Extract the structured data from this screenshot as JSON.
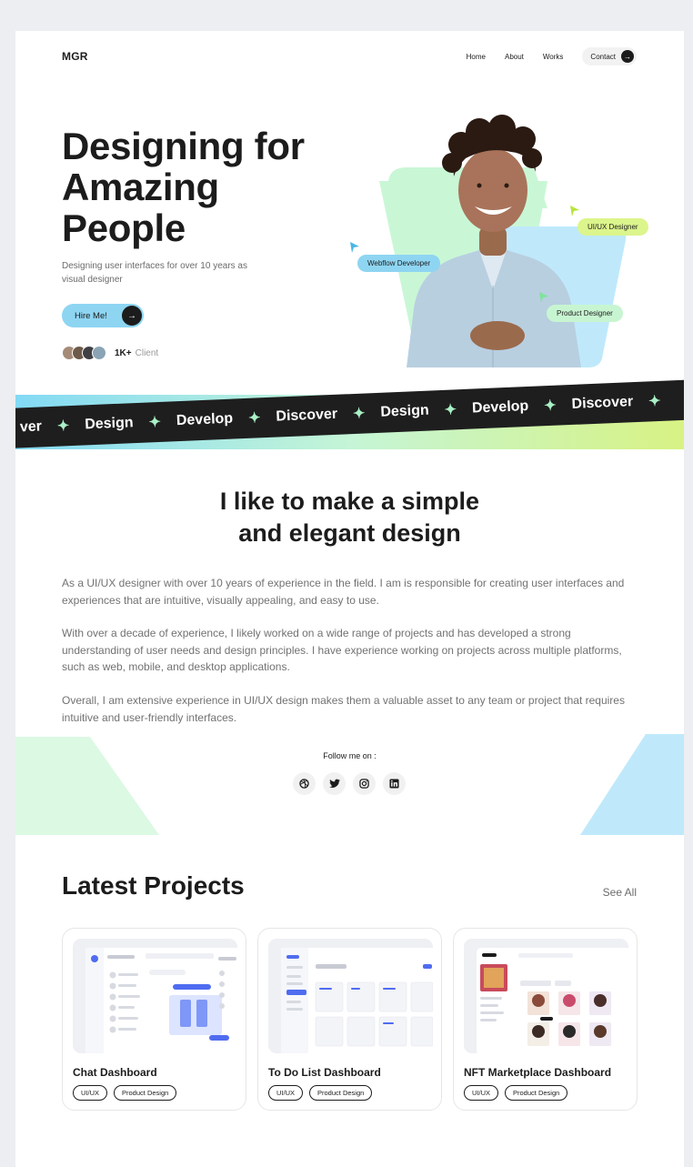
{
  "header": {
    "logo": "MGR",
    "nav": [
      "Home",
      "About",
      "Works"
    ],
    "contact_label": "Contact"
  },
  "hero": {
    "title_lines": [
      "Designing for",
      "Amazing",
      "People"
    ],
    "subtitle": "Designing user interfaces for over 10 years as visual designer",
    "hire_label": "Hire Me!",
    "client_count": "1K+",
    "client_label": "Client",
    "tags": [
      "UI/UX Designer",
      "Webflow Developer",
      "Product Designer"
    ]
  },
  "marquee": {
    "words": [
      "ver",
      "Design",
      "Develop",
      "Discover",
      "Design",
      "Develop",
      "Discover"
    ]
  },
  "about": {
    "title_lines": [
      "I like to make a simple",
      "and elegant design"
    ],
    "paragraphs": [
      "As a UI/UX designer with over 10 years of experience in the field. I am is responsible for creating user interfaces and experiences that are intuitive, visually appealing, and easy to use.",
      "With over a decade of experience, I likely worked on a wide range of projects and has developed a strong understanding of user needs and design principles. I have experience working on projects across multiple platforms, such as web, mobile, and desktop applications.",
      "Overall, I am extensive experience in UI/UX design makes them a valuable asset to any team or project that requires intuitive and user-friendly interfaces."
    ],
    "follow_label": "Follow me on :",
    "socials": [
      "dribbble-icon",
      "twitter-icon",
      "instagram-icon",
      "linkedin-icon"
    ]
  },
  "projects": {
    "title": "Latest Projects",
    "see_all": "See All",
    "items": [
      {
        "title": "Chat Dashboard",
        "tags": [
          "UI/UX",
          "Product Design"
        ]
      },
      {
        "title": "To Do List Dashboard",
        "tags": [
          "UI/UX",
          "Product Design"
        ]
      },
      {
        "title": "NFT Marketplace Dashboard",
        "tags": [
          "UI/UX",
          "Product Design"
        ]
      }
    ]
  },
  "colors": {
    "accent_blue": "#8ed5f2",
    "accent_lime": "#dcf58c",
    "accent_mint": "#c7f5d1",
    "dark": "#1e1e1e"
  }
}
